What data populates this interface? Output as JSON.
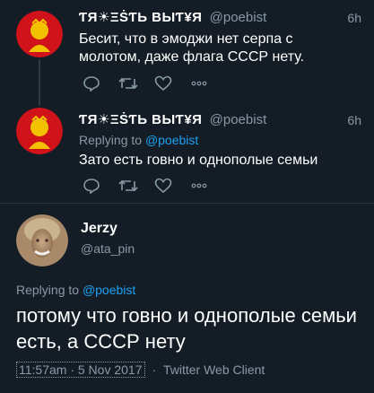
{
  "tweets": [
    {
      "display_name": "ƬЯ☀ΞṠƬЬ ВЫƬ¥Я",
      "handle": "@poebist",
      "time": "6h",
      "text_lines": [
        "Бесит, что в эмоджи нет серпа с",
        "молотом, даже флага СССР нету."
      ]
    },
    {
      "display_name": "ƬЯ☀ΞṠƬЬ ВЫƬ¥Я",
      "handle": "@poebist",
      "time": "6h",
      "replying_to_label": "Replying to",
      "replying_to_handle": "@poebist",
      "text": "Зато есть говно и однополые семьи"
    }
  ],
  "main_tweet": {
    "display_name": "Jerzy",
    "handle": "@ata_pin",
    "replying_to_label": "Replying to",
    "replying_to_handle": "@poebist",
    "text_lines": [
      "потому что говно и однополые семьи",
      "есть, а СССР нету"
    ],
    "timestamp": "11:57am · 5 Nov 2017",
    "separator": "·",
    "client": "Twitter Web Client"
  },
  "icons": {
    "reply": "reply-icon",
    "retweet": "retweet-icon",
    "like": "heart-icon",
    "more": "more-dots-icon"
  },
  "colors": {
    "background": "#141d26",
    "link": "#1da1f2",
    "muted": "#8899a6",
    "avatar_red": "#d0121b"
  }
}
